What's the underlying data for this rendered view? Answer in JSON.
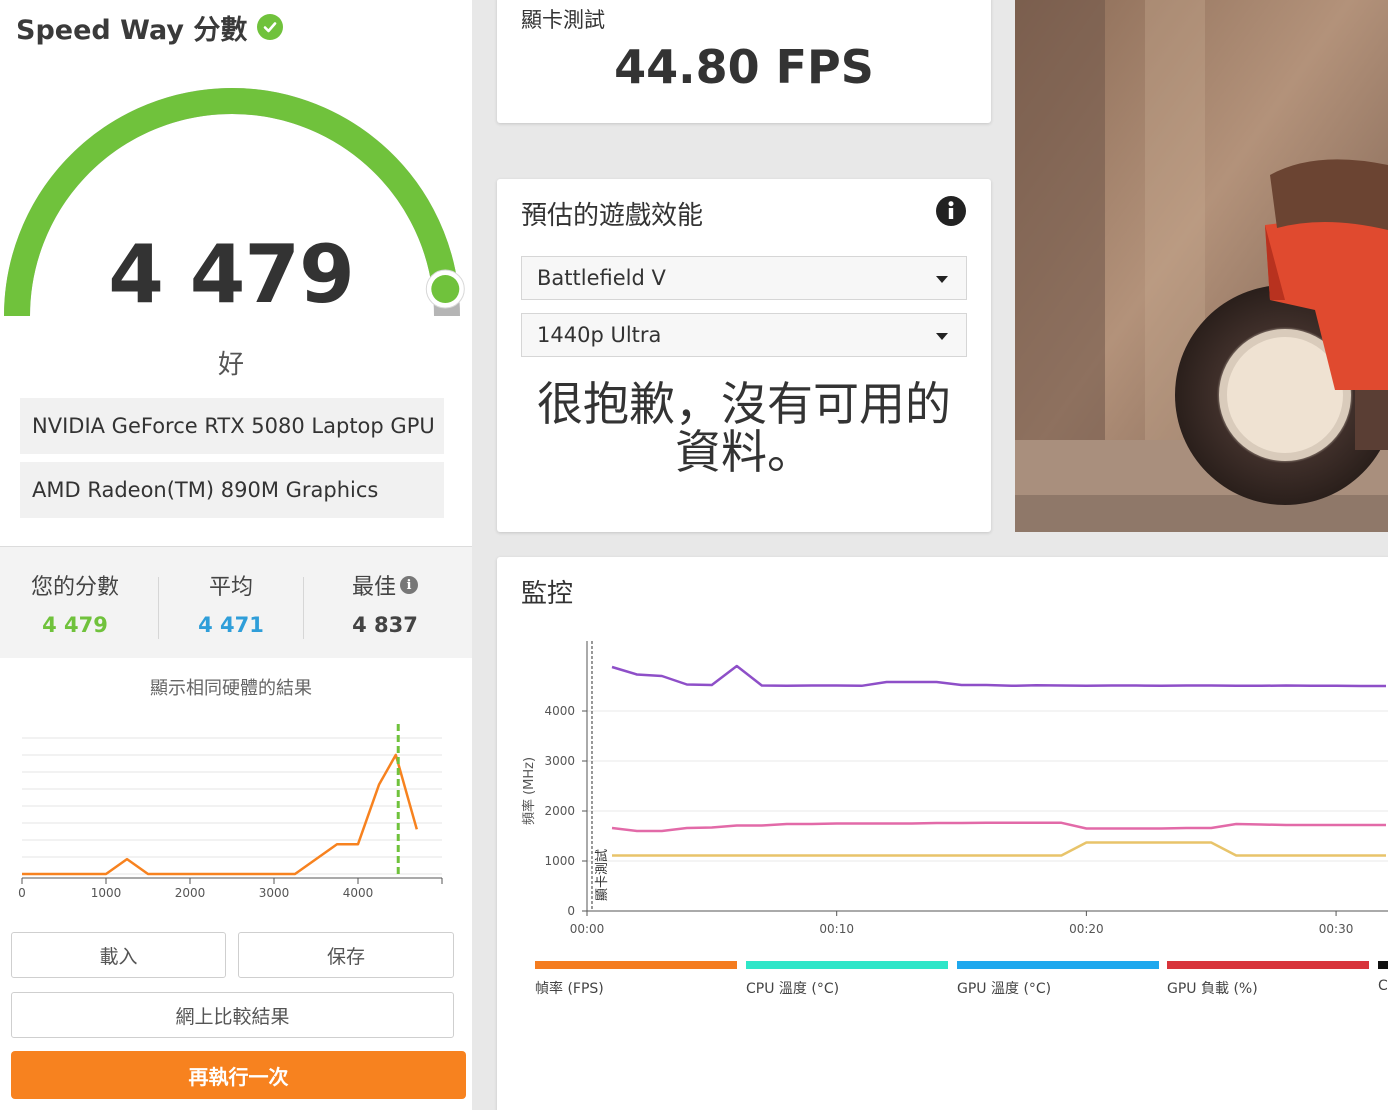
{
  "score_panel": {
    "title": "Speed Way 分數",
    "score": "4 479",
    "rating": "好",
    "gauge_fraction": 0.96,
    "hardware": [
      "NVIDIA GeForce RTX 5080 Laptop GPU",
      "AMD Radeon(TM) 890M Graphics"
    ],
    "your_score_label": "您的分數",
    "your_score": "4 479",
    "average_label": "平均",
    "average": "4 471",
    "best_label": "最佳",
    "best": "4 837",
    "same_hardware_label": "顯示相同硬體的結果",
    "histogram": {
      "x_ticks": [
        "0",
        "1000",
        "2000",
        "3000",
        "4000"
      ],
      "xlim": [
        0,
        5000
      ],
      "points": [
        [
          0,
          0
        ],
        [
          1000,
          0
        ],
        [
          1250,
          1
        ],
        [
          1500,
          0
        ],
        [
          3250,
          0
        ],
        [
          3750,
          2
        ],
        [
          4000,
          2
        ],
        [
          4250,
          6
        ],
        [
          4450,
          8
        ],
        [
          4700,
          3
        ]
      ],
      "marker_x": 4479
    },
    "colors": {
      "green": "#70c23c",
      "blue": "#2f9ed9",
      "orange": "#f7821f",
      "gauge_track": "#b5b5b5"
    }
  },
  "buttons": {
    "load": "載入",
    "save": "保存",
    "compare_online": "網上比較結果",
    "run_again": "再執行一次"
  },
  "gpu_test": {
    "title": "顯卡測試",
    "fps": "44.80 FPS"
  },
  "game_perf": {
    "title": "預估的遊戲效能",
    "game": "Battlefield V",
    "preset": "1440p Ultra",
    "no_data": "很抱歉，沒有可用的資料。"
  },
  "monitor": {
    "title": "監控",
    "legend": [
      "幀率 (FPS)",
      "CPU 溫度 (°C)",
      "GPU 溫度 (°C)",
      "GPU 負載 (%)",
      "C"
    ],
    "legend_colors": [
      "#f47c20",
      "#2ee6c8",
      "#1ea8ee",
      "#d8343b",
      "#111111"
    ]
  },
  "chart_data": {
    "type": "line",
    "ylabel": "頻率 (MHz)",
    "y_ticks": [
      "0",
      "1000",
      "2000",
      "3000",
      "4000"
    ],
    "ylim": [
      0,
      5400
    ],
    "x_ticks": [
      "00:00",
      "00:10",
      "00:20",
      "00:30"
    ],
    "xlim_seconds": [
      0,
      32.2
    ],
    "annotation": "顯卡測試",
    "annotation_x_seconds": 0.2,
    "series": [
      {
        "color": "#8e4fc8",
        "x": [
          1,
          2,
          3,
          4,
          5,
          6,
          7,
          8,
          9,
          10,
          11,
          12,
          13,
          14,
          15,
          16,
          17,
          18,
          19,
          20,
          21,
          22,
          23,
          24,
          25,
          26,
          27,
          28,
          29,
          30,
          31,
          32
        ],
        "values": [
          4880,
          4730,
          4700,
          4530,
          4520,
          4900,
          4510,
          4505,
          4510,
          4510,
          4505,
          4580,
          4580,
          4580,
          4520,
          4520,
          4505,
          4515,
          4510,
          4505,
          4510,
          4510,
          4505,
          4510,
          4510,
          4505,
          4505,
          4510,
          4505,
          4505,
          4500,
          4500
        ]
      },
      {
        "color": "#e26aa8",
        "x": [
          1,
          2,
          3,
          4,
          5,
          6,
          7,
          8,
          9,
          10,
          11,
          12,
          13,
          14,
          15,
          16,
          17,
          18,
          19,
          20,
          21,
          22,
          23,
          24,
          25,
          26,
          27,
          28,
          29,
          30,
          31,
          32
        ],
        "values": [
          1660,
          1600,
          1600,
          1660,
          1670,
          1710,
          1710,
          1740,
          1740,
          1750,
          1750,
          1750,
          1750,
          1760,
          1760,
          1765,
          1765,
          1765,
          1765,
          1650,
          1650,
          1650,
          1650,
          1660,
          1660,
          1740,
          1730,
          1720,
          1720,
          1720,
          1720,
          1720
        ]
      },
      {
        "color": "#e8c46a",
        "x": [
          1,
          2,
          3,
          4,
          5,
          6,
          7,
          8,
          9,
          10,
          11,
          12,
          13,
          14,
          15,
          16,
          17,
          18,
          19,
          20,
          21,
          22,
          23,
          24,
          25,
          26,
          27,
          28,
          29,
          30,
          31,
          32
        ],
        "values": [
          1110,
          1110,
          1110,
          1110,
          1110,
          1110,
          1110,
          1110,
          1110,
          1110,
          1110,
          1110,
          1110,
          1110,
          1110,
          1110,
          1110,
          1110,
          1110,
          1370,
          1370,
          1370,
          1370,
          1370,
          1370,
          1110,
          1110,
          1110,
          1110,
          1110,
          1110,
          1110
        ]
      }
    ]
  }
}
